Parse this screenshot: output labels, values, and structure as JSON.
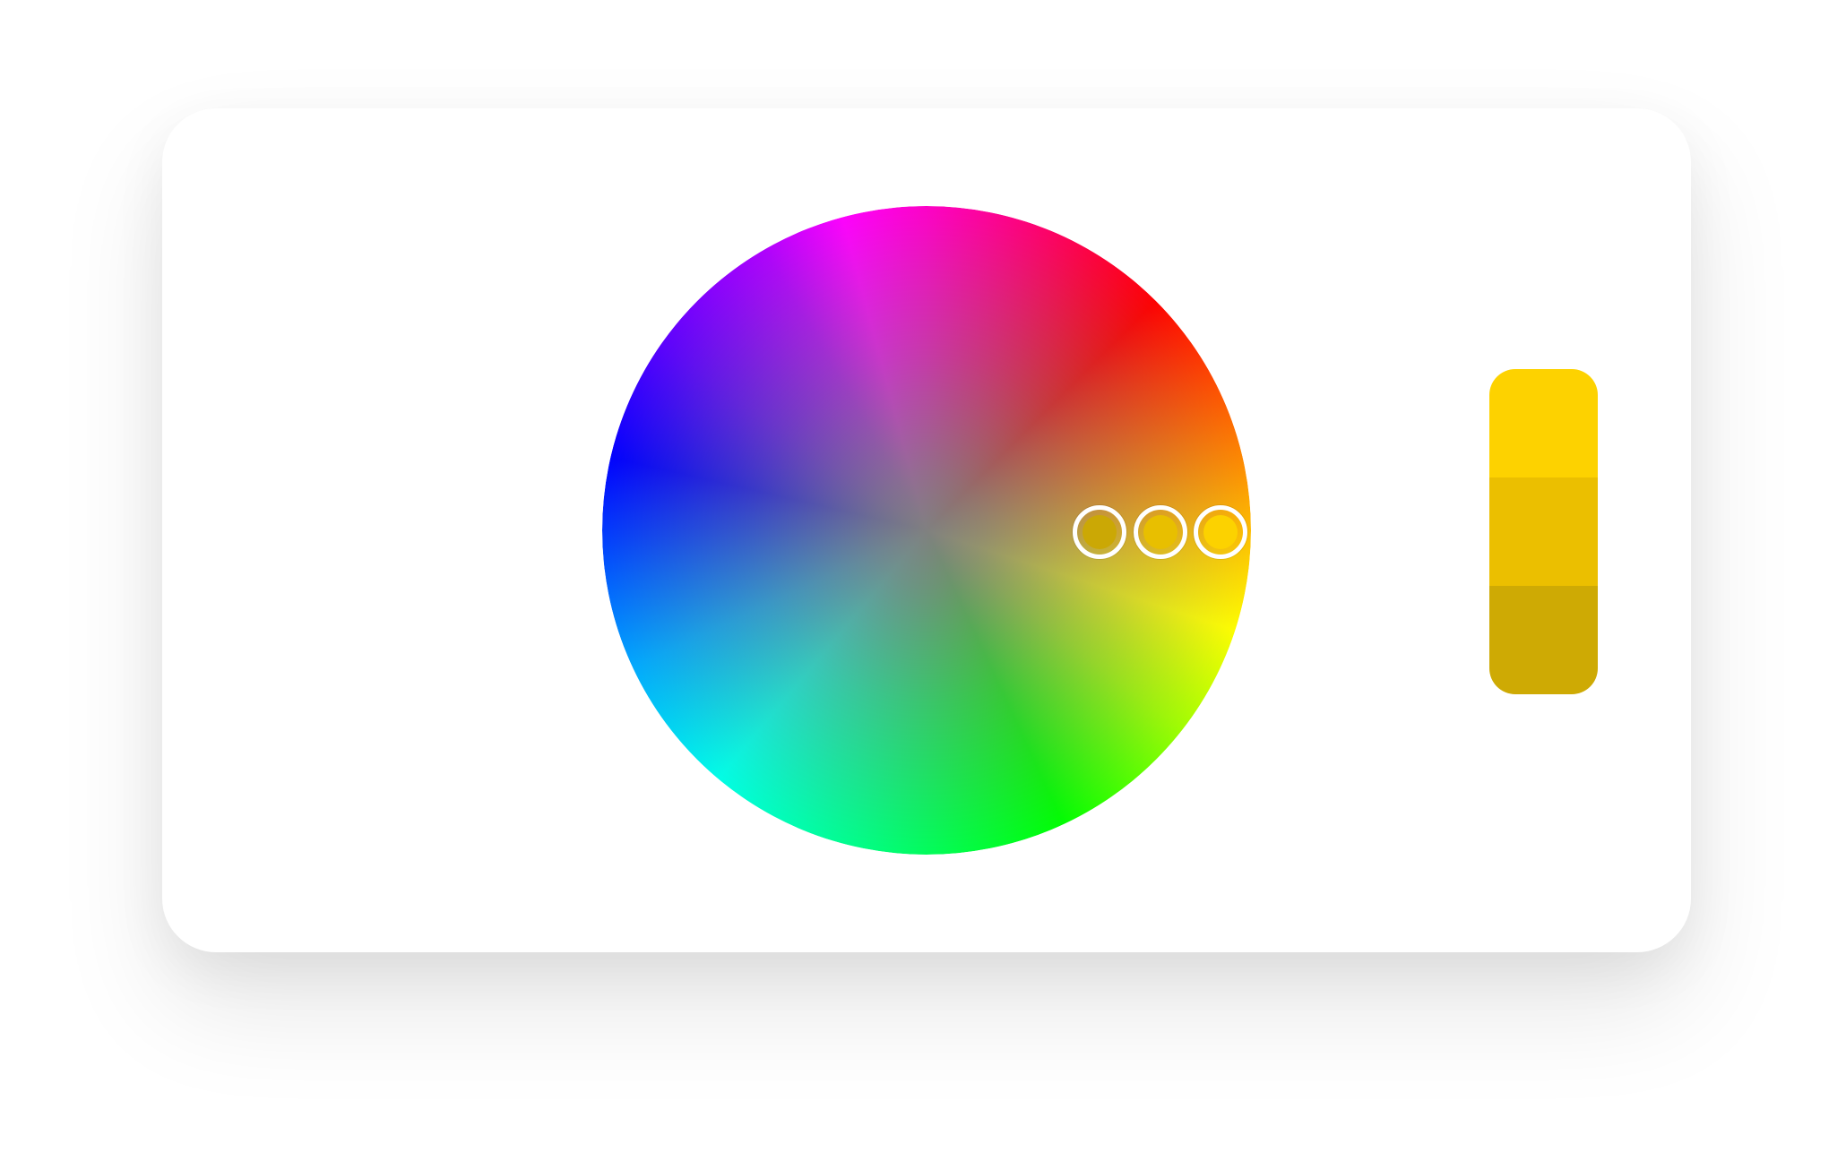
{
  "color_picker": {
    "handles": [
      {
        "name": "handle-1",
        "color": "#CBA805"
      },
      {
        "name": "handle-2",
        "color": "#E8BF00"
      },
      {
        "name": "handle-3",
        "color": "#FCD200"
      }
    ],
    "palette": [
      {
        "color": "#FDD200"
      },
      {
        "color": "#EBBF00"
      },
      {
        "color": "#CEAA04"
      }
    ]
  }
}
